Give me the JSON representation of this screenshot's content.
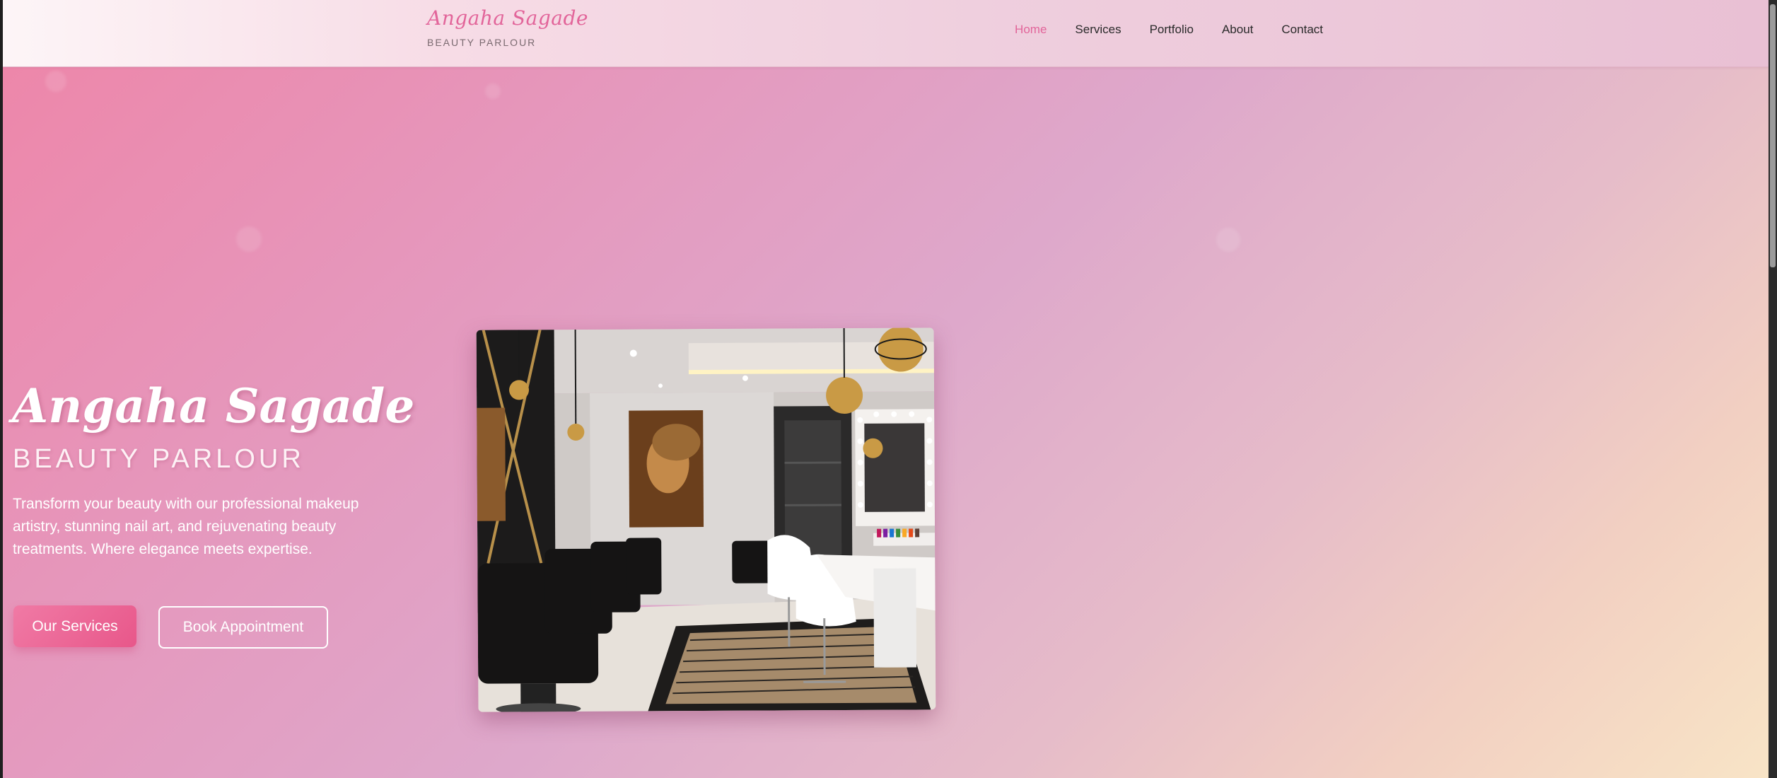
{
  "brand": {
    "name": "Angaha Sagade",
    "tagline": "BEAUTY PARLOUR"
  },
  "nav": {
    "items": [
      {
        "label": "Home",
        "active": true
      },
      {
        "label": "Services",
        "active": false
      },
      {
        "label": "Portfolio",
        "active": false
      },
      {
        "label": "About",
        "active": false
      },
      {
        "label": "Contact",
        "active": false
      }
    ]
  },
  "hero": {
    "title": "Angaha Sagade",
    "subtitle": "BEAUTY PARLOUR",
    "description": "Transform your beauty with our professional makeup artistry, stunning nail art, and rejuvenating beauty treatments. Where elegance meets expertise.",
    "primary_button": "Our Services",
    "secondary_button": "Book Appointment",
    "image_subject": "salon interior photo"
  },
  "colors": {
    "accent": "#e2659a",
    "button_gradient_start": "#f07aa5",
    "button_gradient_end": "#e8578a",
    "background_start": "#ee85a8",
    "background_end": "#f8e4c6"
  }
}
